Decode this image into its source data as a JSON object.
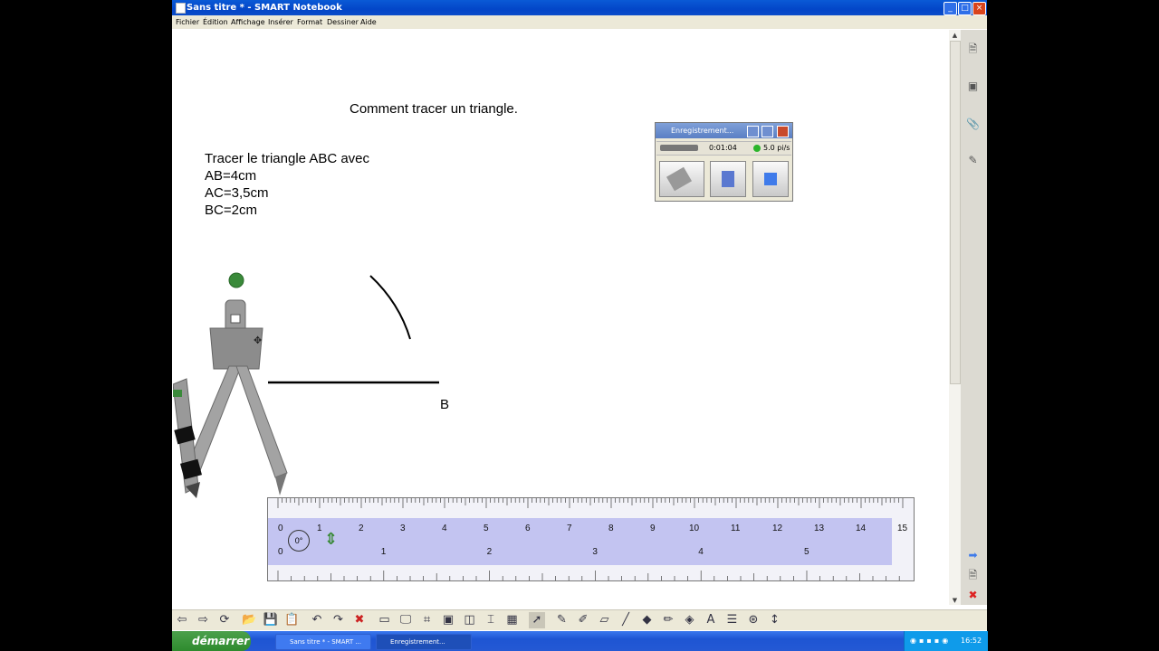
{
  "window": {
    "title": "Sans titre * - SMART Notebook",
    "controls": {
      "min": "_",
      "max": "□",
      "close": "×"
    }
  },
  "menu": [
    "Fichier",
    "Édition",
    "Affichage",
    "Insérer",
    "Format",
    "Dessiner",
    "Aide"
  ],
  "canvas": {
    "heading": "Comment tracer un triangle.",
    "task_line1": "Tracer le triangle ABC avec",
    "task_line2": "AB=4cm",
    "task_line3": "AC=3,5cm",
    "task_line4": "BC=2cm",
    "point_b": "B"
  },
  "recorder": {
    "title": "Enregistrement...",
    "time": "0:01:04",
    "fps": "5.0 pi/s",
    "status_color": "#2bb52b",
    "buttons": [
      "record-icon",
      "pause-icon",
      "stop-icon"
    ]
  },
  "ruler": {
    "cm_labels": [
      "0",
      "1",
      "2",
      "3",
      "4",
      "5",
      "6",
      "7",
      "8",
      "9",
      "10",
      "11",
      "12",
      "13",
      "14",
      "15"
    ],
    "inch_labels": [
      "0",
      "1",
      "2",
      "3",
      "4",
      "5"
    ],
    "angle": "0°"
  },
  "toolbar_icons": [
    "back-icon",
    "forward-icon",
    "refresh-icon",
    "open-folder-icon",
    "save-icon",
    "paste-icon",
    "undo-icon",
    "redo-icon",
    "delete-icon",
    "screen-shade-icon",
    "full-screen-icon",
    "capture-icon",
    "display-icon",
    "area-icon",
    "text-icon",
    "table-icon",
    "select-icon",
    "pen-icon",
    "creative-pen-icon",
    "eraser-icon",
    "line-icon",
    "fill-icon",
    "magic-pen-icon",
    "shape-icon",
    "text-tool-icon",
    "properties-icon",
    "recognize-icon",
    "more-icon"
  ],
  "taskbar": {
    "start": "démarrer",
    "tasks": [
      "Sans titre * - SMART ...",
      "Enregistrement..."
    ],
    "clock": "16:52"
  }
}
